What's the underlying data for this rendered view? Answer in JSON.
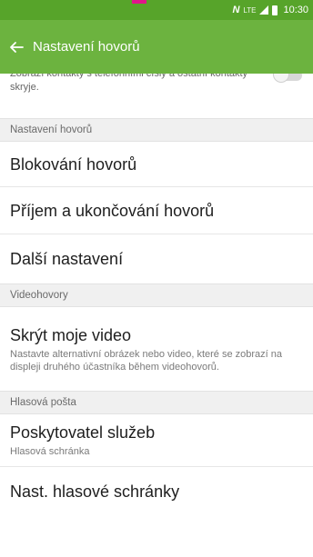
{
  "status_bar": {
    "lte": "LTE",
    "time": "10:30"
  },
  "app_bar": {
    "title": "Nastavení hovorů"
  },
  "partial_item": {
    "text": "Zobrazí kontakty s telefonními čísly a ostatní kontakty skryje."
  },
  "sections": {
    "call_settings": "Nastavení hovorů",
    "video_calls": "Videohovory",
    "voicemail": "Hlasová pošta"
  },
  "items": {
    "call_blocking": "Blokování hovorů",
    "answer_end": "Příjem a ukončování hovorů",
    "more_settings": "Další nastavení",
    "hide_video": {
      "title": "Skrýt moje video",
      "subtitle": "Nastavte alternativní obrázek nebo video, které se zobrazí na displeji druhého účastníka během videohovorů."
    },
    "service_provider": {
      "title": "Poskytovatel služeb",
      "subtitle": "Hlasová schránka"
    },
    "voicemail_settings": "Nast. hlasové schránky"
  },
  "colors": {
    "status_bar": "#57a42a",
    "app_bar": "#6cb33f",
    "top_marker": "#e0158a"
  },
  "icons": {
    "back": "arrow-left",
    "nfc": "nfc",
    "signal": "cellular-signal",
    "battery": "battery"
  }
}
